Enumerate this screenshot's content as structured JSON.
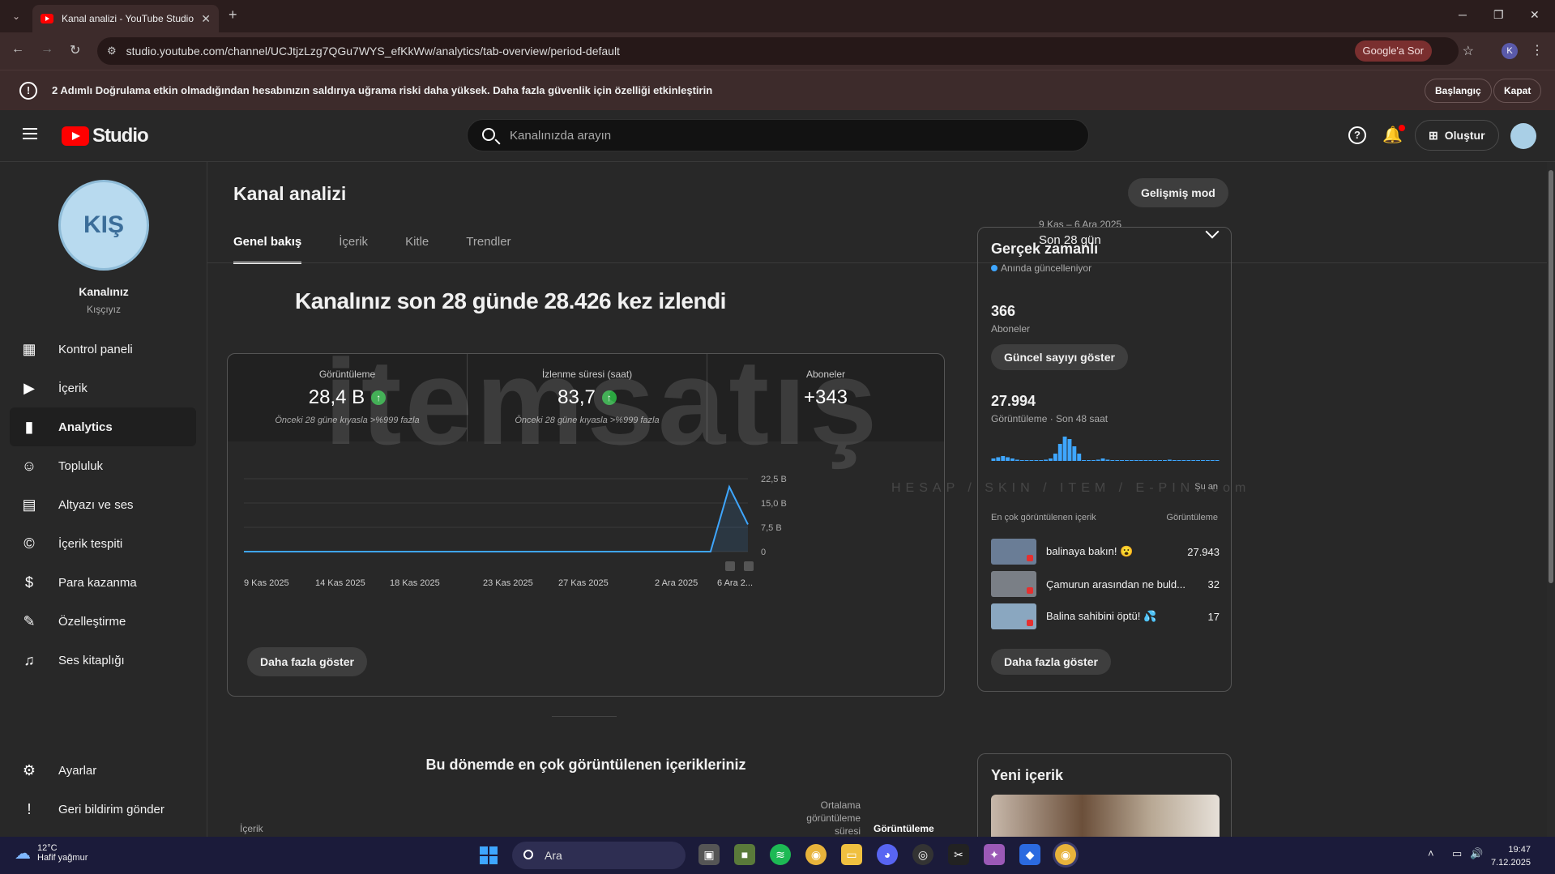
{
  "browser": {
    "tab_title": "Kanal analizi - YouTube Studio",
    "url": "studio.youtube.com/channel/UCJtjzLzg7QGu7WYS_efKkWw/analytics/tab-overview/period-default",
    "google_sor": "Google'a Sor",
    "profile_initial": "K"
  },
  "warning": {
    "text": "2 Adımlı Doğrulama etkin olmadığından hesabınızın saldırıya uğrama riski daha yüksek. Daha fazla güvenlik için özelliği etkinleştirin",
    "start_label": "Başlangıç",
    "close_label": "Kapat"
  },
  "header": {
    "logo_text": "Studio",
    "search_placeholder": "Kanalınızda arayın",
    "create_label": "Oluştur"
  },
  "sidebar": {
    "channel_name": "Kanalınız",
    "channel_handle": "Kışçıyız",
    "avatar_text": "KIŞ",
    "items": [
      {
        "label": "Kontrol paneli",
        "icon": "dashboard-icon"
      },
      {
        "label": "İçerik",
        "icon": "content-icon"
      },
      {
        "label": "Analytics",
        "icon": "analytics-icon"
      },
      {
        "label": "Topluluk",
        "icon": "community-icon"
      },
      {
        "label": "Altyazı ve ses",
        "icon": "subtitles-icon"
      },
      {
        "label": "İçerik tespiti",
        "icon": "copyright-icon"
      },
      {
        "label": "Para kazanma",
        "icon": "monetization-icon"
      },
      {
        "label": "Özelleştirme",
        "icon": "customization-icon"
      },
      {
        "label": "Ses kitaplığı",
        "icon": "audio-library-icon"
      }
    ],
    "settings_label": "Ayarlar",
    "feedback_label": "Geri bildirim gönder"
  },
  "main": {
    "title": "Kanal analizi",
    "advanced_mode": "Gelişmiş mod",
    "tabs": [
      "Genel bakış",
      "İçerik",
      "Kitle",
      "Trendler"
    ],
    "period_range": "9 Kas – 6 Ara 2025",
    "period_label": "Son 28 gün",
    "headline": "Kanalınız son 28 günde 28.426 kez izlendi",
    "metrics": [
      {
        "label": "Görüntüleme",
        "value": "28,4 B",
        "compare": "Önceki 28 güne kıyasla >%999 fazla"
      },
      {
        "label": "İzlenme süresi (saat)",
        "value": "83,7",
        "compare": "Önceki 28 güne kıyasla >%999 fazla"
      },
      {
        "label": "Aboneler",
        "value": "+343",
        "compare": ""
      }
    ],
    "more_label": "Daha fazla göster",
    "top_content_title": "Bu dönemde en çok görüntülenen içerikleriniz",
    "table_headers": {
      "content": "İçerik",
      "avg_duration": "Ortalama görüntüleme süresi",
      "views": "Görüntüleme"
    }
  },
  "chart_data": {
    "type": "line",
    "x": [
      "9 Kas 2025",
      "14 Kas 2025",
      "18 Kas 2025",
      "23 Kas 2025",
      "27 Kas 2025",
      "2 Ara 2025",
      "6 Ara 2..."
    ],
    "y_ticks": [
      "22,5 B",
      "15,0 B",
      "7,5 B",
      "0"
    ],
    "ylim": [
      0,
      22500
    ],
    "series": [
      {
        "values": [
          0,
          0,
          0,
          0,
          0,
          0,
          0,
          0,
          0,
          0,
          0,
          0,
          0,
          0,
          0,
          0,
          0,
          0,
          0,
          0,
          0,
          0,
          0,
          0,
          0,
          0,
          20000,
          8400
        ]
      }
    ],
    "color": "#3ea6ff"
  },
  "realtime": {
    "title": "Gerçek zamanlı",
    "live_label": "Anında güncelleniyor",
    "subs_value": "366",
    "subs_label": "Aboneler",
    "show_count_label": "Güncel sayıyı göster",
    "views_value": "27.994",
    "views_label": "Görüntüleme · Son 48 saat",
    "now_label": "Şu an",
    "top_label": "En çok görüntülenen içerik",
    "top_views_label": "Görüntüleme",
    "videos": [
      {
        "title": "balinaya bakın! 😮",
        "views": "27.943"
      },
      {
        "title": "Çamurun arasından ne buld...",
        "views": "32"
      },
      {
        "title": "Balina sahibini öptü! 💦",
        "views": "17"
      }
    ],
    "more_label": "Daha fazla göster",
    "bars": [
      0.1,
      0.15,
      0.2,
      0.15,
      0.1,
      0.05,
      0,
      0,
      0,
      0,
      0,
      0.05,
      0.1,
      0.3,
      0.7,
      1.0,
      0.9,
      0.6,
      0.3,
      0,
      0,
      0,
      0.05,
      0.1,
      0.05,
      0,
      0,
      0,
      0,
      0,
      0,
      0,
      0,
      0,
      0,
      0,
      0,
      0.05,
      0,
      0,
      0,
      0,
      0,
      0,
      0,
      0,
      0,
      0
    ]
  },
  "new_content": {
    "title": "Yeni içerik"
  },
  "watermark": {
    "text": "itemsatış",
    "subtext": "HESAP / SKIN / ITEM / E-PIN .com"
  },
  "taskbar": {
    "temp": "12°C",
    "weather": "Hafif yağmur",
    "search_label": "Ara",
    "time": "19:47",
    "date": "7.12.2025"
  }
}
